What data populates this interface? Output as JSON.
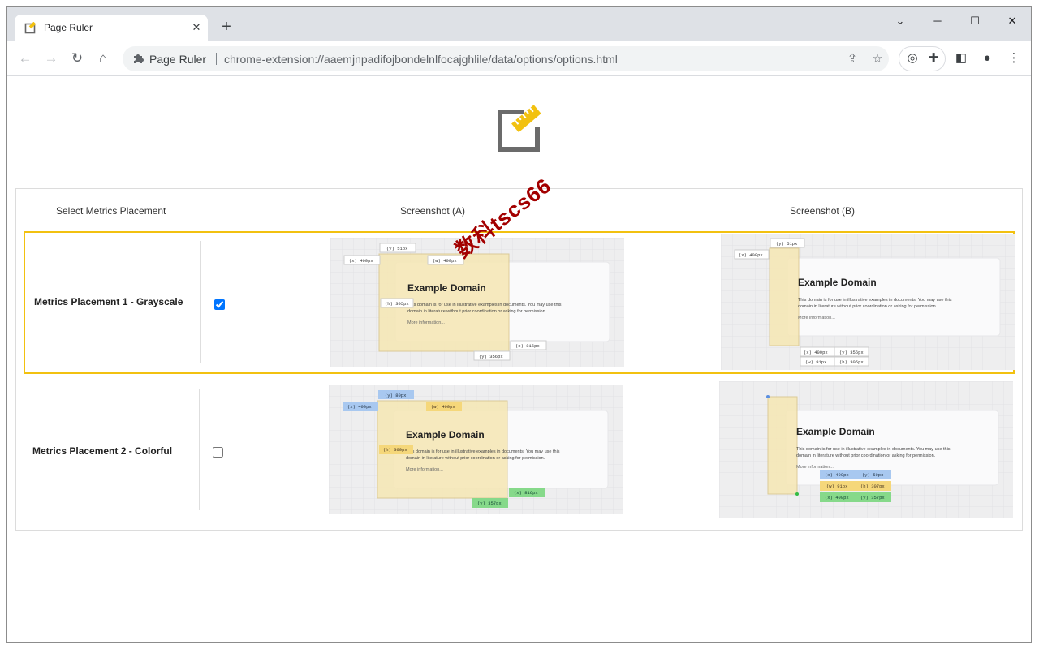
{
  "browser": {
    "tab_title": "Page Ruler",
    "tab_close": "✕",
    "new_tab": "+",
    "window_controls": {
      "minimize": "─",
      "maximize": "☐",
      "close": "✕",
      "chevron": "⌄"
    },
    "omnibox": {
      "extension_name": "Page Ruler",
      "url": "chrome-extension://aaemjnpadifojbondelnlfocajghlile/data/options/options.html"
    }
  },
  "page": {
    "headers": {
      "select": "Select Metrics Placement",
      "shot_a": "Screenshot (A)",
      "shot_b": "Screenshot (B)"
    },
    "rows": [
      {
        "label": "Metrics Placement 1 - Grayscale",
        "checked": true
      },
      {
        "label": "Metrics Placement 2 - Colorful",
        "checked": false
      }
    ],
    "watermark": "数科tscs66",
    "example": {
      "title": "Example Domain",
      "line1": "This domain is for use in illustrative examples in documents. You may use this",
      "line2": "domain in literature without prior coordination or asking for permission.",
      "link": "More information..."
    },
    "shot_a_gray": {
      "y": "(y) 51px",
      "x": "(x) 400px",
      "w": "(w) 400px",
      "h": "(h) 305px",
      "x2": "(x) 816px",
      "y2": "(y) 356px"
    },
    "shot_b_gray": {
      "y": "(y) 51px",
      "x": "(x) 400px",
      "c1": "(x) 400px",
      "c2": "(y) 356px",
      "c3": "(w) 91px",
      "c4": "(h) 305px"
    },
    "shot_a_color": {
      "y": "(y) 80px",
      "x": "(x) 400px",
      "w": "(w) 400px",
      "h": "(h) 300px",
      "x2": "(x) 816px",
      "y2": "(y) 357px"
    },
    "shot_b_color": {
      "c1": "(x) 400px",
      "c2": "(y) 50px",
      "c3": "(w) 91px",
      "c4": "(h) 307px",
      "c5": "(x) 400px",
      "c6": "(y) 357px"
    }
  },
  "colors": {
    "accent": "#f2c110",
    "blue_tag": "#a8c8f0",
    "yellow_tag": "#f5d77a",
    "green_tag": "#86d98a",
    "overlay": "#f6e7b4"
  }
}
